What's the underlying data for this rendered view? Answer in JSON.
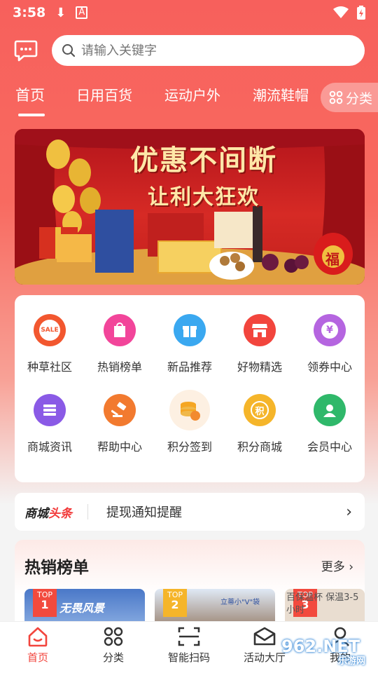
{
  "status": {
    "time": "3:58"
  },
  "search": {
    "placeholder": "请输入关键字"
  },
  "tabs": [
    {
      "label": "首页"
    },
    {
      "label": "日用百货"
    },
    {
      "label": "运动户外"
    },
    {
      "label": "潮流鞋帽"
    }
  ],
  "category_button": {
    "label": "分类"
  },
  "banner": {
    "line1": "优惠不间断",
    "line2": "让利大狂欢",
    "lucky": "福"
  },
  "grid": [
    {
      "label": "种草社区",
      "icon": "sale-icon",
      "badge": "SALE",
      "color": "#f2572f"
    },
    {
      "label": "热销榜单",
      "icon": "tag-icon",
      "badge": "",
      "color": "#f2459a"
    },
    {
      "label": "新品推荐",
      "icon": "gift-icon",
      "badge": "",
      "color": "#3aa8f0"
    },
    {
      "label": "好物精选",
      "icon": "store-icon",
      "badge": "",
      "color": "#f2453d"
    },
    {
      "label": "领券中心",
      "icon": "coupon-icon",
      "badge": "¥",
      "color": "#b565e0"
    },
    {
      "label": "商城资讯",
      "icon": "news-icon",
      "badge": "",
      "color": "#8a5ae6"
    },
    {
      "label": "帮助中心",
      "icon": "gavel-icon",
      "badge": "",
      "color": "#f27a2f"
    },
    {
      "label": "积分签到",
      "icon": "coins-icon",
      "badge": "",
      "color": "#f5a623"
    },
    {
      "label": "积分商城",
      "icon": "points-icon",
      "badge": "积",
      "color": "#f5b52a"
    },
    {
      "label": "会员中心",
      "icon": "member-icon",
      "badge": "",
      "color": "#2fb86a"
    }
  ],
  "news": {
    "logo_black": "商城",
    "logo_red": "头条",
    "text": "提现通知提醒"
  },
  "hot": {
    "title": "热销榜单",
    "more": "更多",
    "cards": [
      {
        "badge_top": "TOP",
        "rank": "1",
        "caption": "无畏风景"
      },
      {
        "badge_top": "TOP",
        "rank": "2",
        "caption": "立蒂小\"V\"袋"
      },
      {
        "badge_top": "TOP",
        "rank": "3",
        "caption": "百保温杯 保温3-5小时"
      }
    ]
  },
  "bottom_nav": [
    {
      "label": "首页",
      "icon": "home-icon"
    },
    {
      "label": "分类",
      "icon": "grid-icon"
    },
    {
      "label": "智能扫码",
      "icon": "scan-icon"
    },
    {
      "label": "活动大厅",
      "icon": "mail-icon"
    },
    {
      "label": "我的",
      "icon": "user-icon"
    }
  ],
  "watermark": {
    "text": "962.NET",
    "sub": "乐游网"
  },
  "colors": {
    "primary": "#f2453d",
    "bg_top": "#f7605c"
  }
}
